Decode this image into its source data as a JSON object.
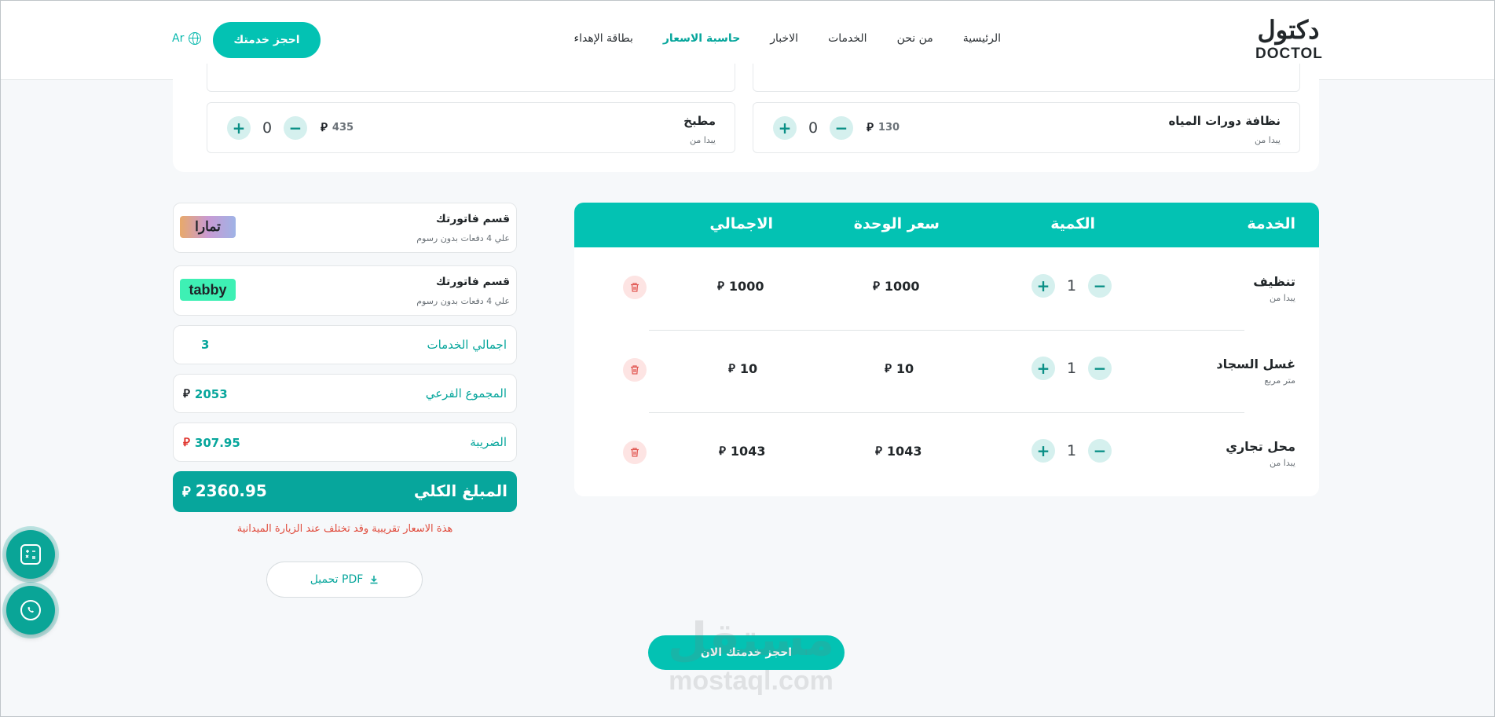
{
  "header": {
    "logo_ar": "دكتول",
    "logo_en": "DOCTOL",
    "nav": [
      "الرئيسية",
      "من نحن",
      "الخدمات",
      "الاخبار",
      "حاسبة الاسعار",
      "بطاقة الإهداء"
    ],
    "active_nav": "حاسبة الاسعار",
    "book_button": "احجز خدمتك",
    "lang": "Ar"
  },
  "services": [
    {
      "name": "نظافة دورات المياه",
      "sub": "يبدا من",
      "price": "130",
      "qty": "0"
    },
    {
      "name": "مطبخ",
      "sub": "يبدا من",
      "price": "435",
      "qty": "0"
    }
  ],
  "currency_symbol": "⃁",
  "table": {
    "headers": {
      "service": "الخدمة",
      "qty": "الكمية",
      "unit_price": "سعر الوحدة",
      "total": "الاجمالي"
    },
    "rows": [
      {
        "name": "تنظيف",
        "sub": "يبدا من",
        "qty": "1",
        "unit_price": "1000",
        "total": "1000"
      },
      {
        "name": "غسل السجاد",
        "sub": "متر مربع",
        "qty": "1",
        "unit_price": "10",
        "total": "10"
      },
      {
        "name": "محل تجاري",
        "sub": "يبدا من",
        "qty": "1",
        "unit_price": "1043",
        "total": "1043"
      }
    ]
  },
  "summary": {
    "tamara": {
      "title": "قسم فاتورتك",
      "sub": "علي 4 دفعات بدون رسوم",
      "logo": "تمارا"
    },
    "tabby": {
      "title": "قسم فاتورتك",
      "sub": "علي 4 دفعات بدون رسوم",
      "logo": "tabby"
    },
    "services_count_label": "اجمالي الخدمات",
    "services_count": "3",
    "subtotal_label": "المجموع الفرعي",
    "subtotal": "2053",
    "tax_label": "الضريبة",
    "tax": "307.95",
    "total_label": "المبلغ الكلي",
    "total": "2360.95",
    "note": "هذة الاسعار تقريبية وقد تختلف عند الزيارة الميدانية",
    "pdf_button": "تحميل PDF"
  },
  "cta": "احجز خدمتك الان",
  "watermark": {
    "ar": "مستقل",
    "en": "mostaql.com"
  },
  "colors": {
    "primary": "#03c2b3",
    "dark_teal": "#07a69c",
    "danger": "#e04b3c"
  }
}
